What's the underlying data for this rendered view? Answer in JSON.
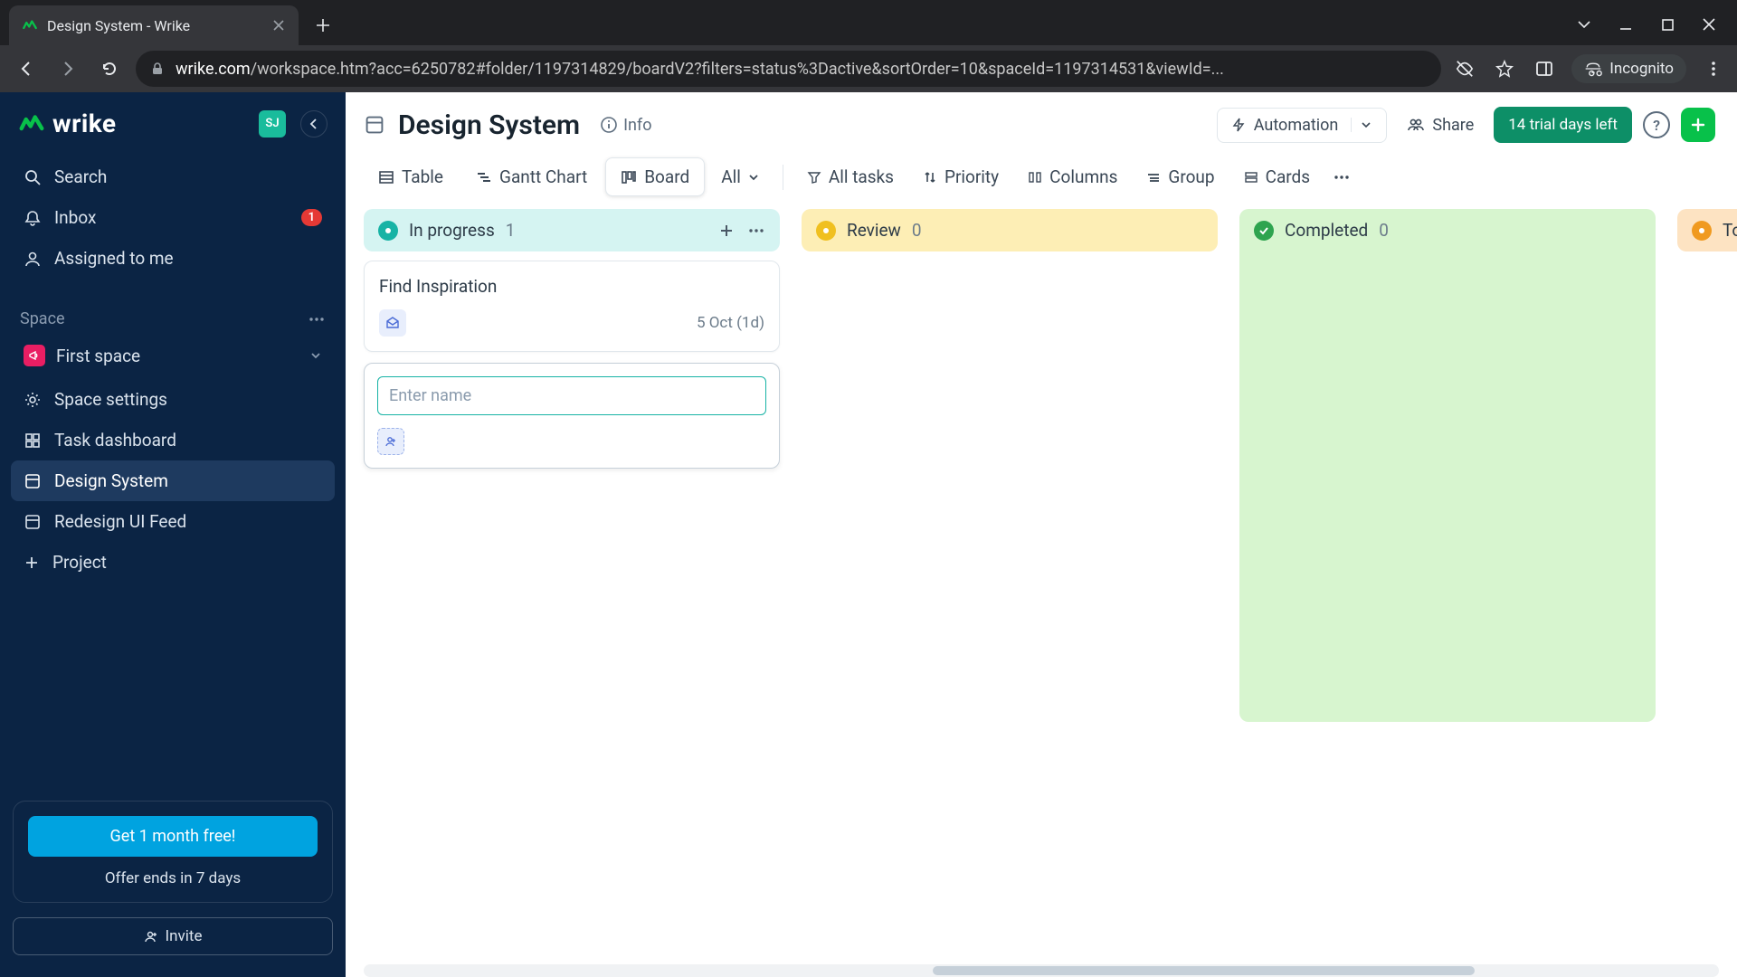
{
  "browser": {
    "tab_title": "Design System - Wrike",
    "url_host": "wrike.com",
    "url_path": "/workspace.htm?acc=6250782#folder/1197314829/boardV2?filters=status%3Dactive&sortOrder=10&spaceId=1197314531&viewId=...",
    "incognito": "Incognito"
  },
  "sidebar": {
    "brand": "wrike",
    "avatar": "SJ",
    "search": "Search",
    "inbox": "Inbox",
    "inbox_badge": "1",
    "assigned": "Assigned to me",
    "space_heading": "Space",
    "space_name": "First space",
    "items": [
      {
        "label": "Space settings"
      },
      {
        "label": "Task dashboard"
      },
      {
        "label": "Design System"
      },
      {
        "label": "Redesign UI Feed"
      },
      {
        "label": "Project"
      }
    ],
    "promo_cta": "Get 1 month free!",
    "promo_sub": "Offer ends in 7 days",
    "invite": "Invite"
  },
  "header": {
    "title": "Design System",
    "info": "Info",
    "automation": "Automation",
    "share": "Share",
    "trial": "14 trial days left"
  },
  "views": {
    "table": "Table",
    "gantt": "Gantt Chart",
    "board": "Board",
    "all": "All",
    "all_tasks": "All tasks",
    "priority": "Priority",
    "columns": "Columns",
    "group": "Group",
    "cards": "Cards"
  },
  "board": {
    "columns": [
      {
        "name": "In progress",
        "count": "1"
      },
      {
        "name": "Review",
        "count": "0"
      },
      {
        "name": "Completed",
        "count": "0"
      },
      {
        "name": "To be si",
        "count": ""
      }
    ],
    "card1_title": "Find Inspiration",
    "card1_date": "5 Oct (1d)",
    "new_placeholder": "Enter name"
  }
}
